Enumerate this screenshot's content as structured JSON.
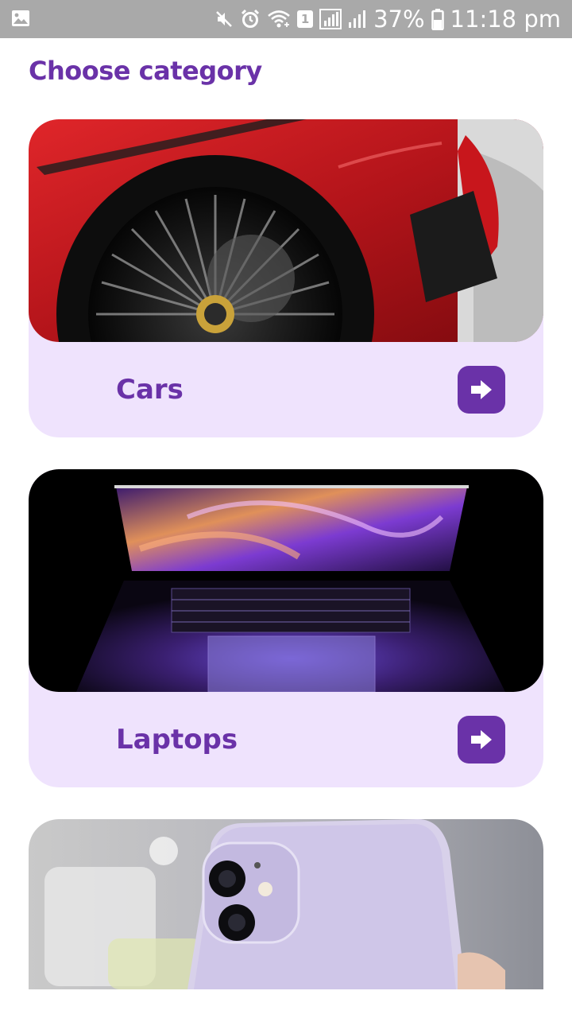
{
  "status_bar": {
    "notification_badge": "1",
    "battery_percent": "37%",
    "time": "11:18 pm"
  },
  "page": {
    "title": "Choose category"
  },
  "categories": [
    {
      "label": "Cars",
      "image": "red sports car wheel photo",
      "action_icon": "arrow-right-icon"
    },
    {
      "label": "Laptops",
      "image": "open laptop with purple screen photo",
      "action_icon": "arrow-right-icon"
    },
    {
      "label": "",
      "image": "lavender smartphone camera photo",
      "action_icon": ""
    }
  ],
  "colors": {
    "accent": "#6a32a8",
    "card_background": "#efe3fd",
    "status_bar": "#a9a9a9"
  }
}
